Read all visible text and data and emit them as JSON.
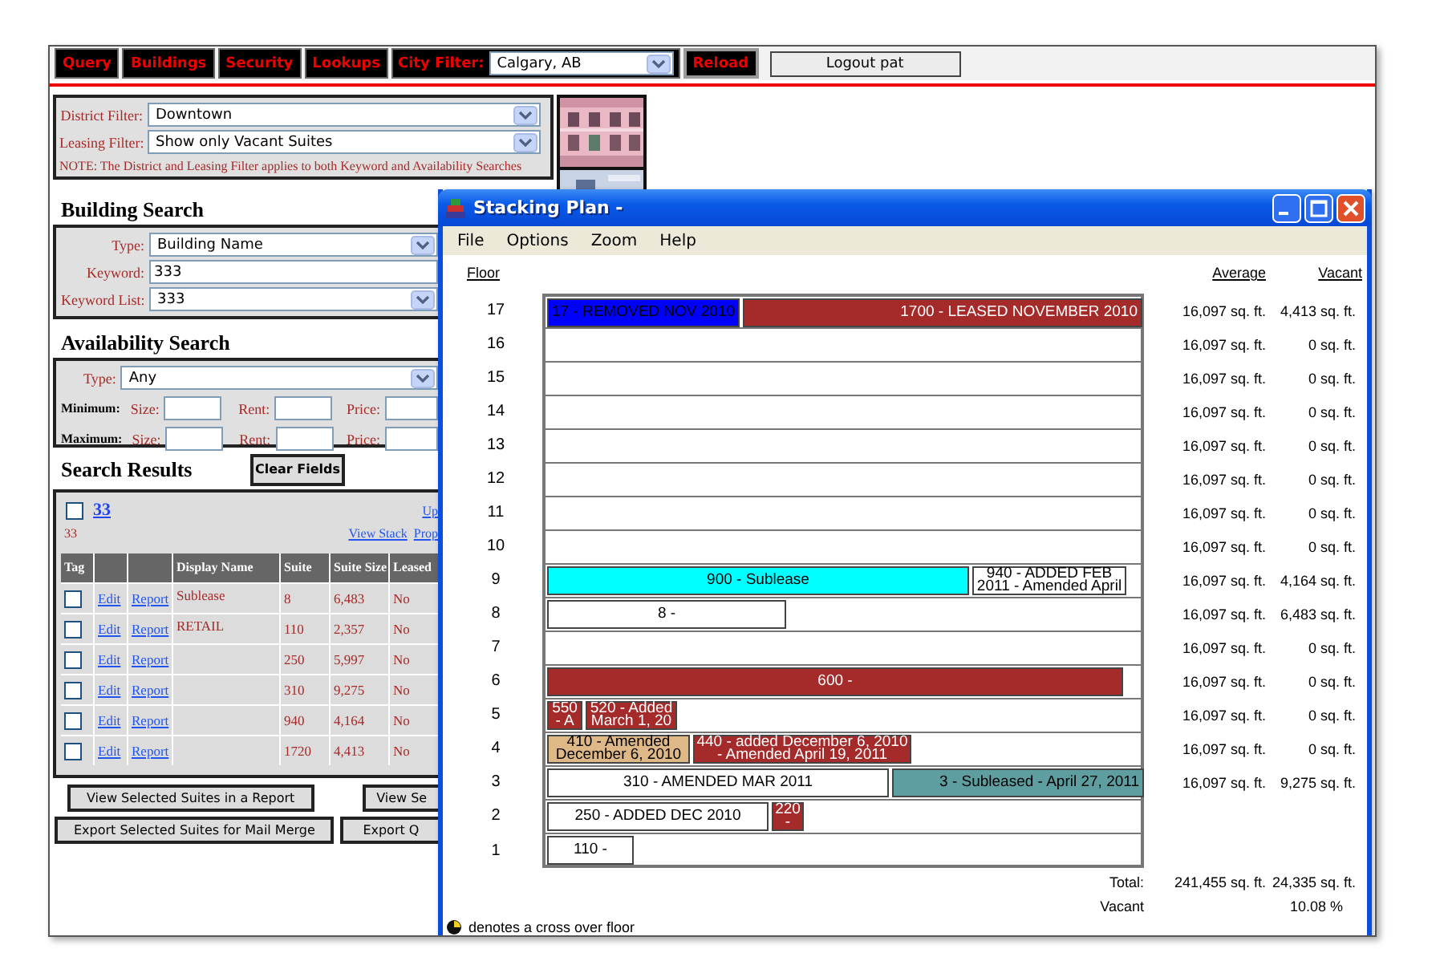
{
  "nav": {
    "buttons": [
      "Query",
      "Buildings",
      "Security",
      "Lookups"
    ],
    "city_filter": {
      "label": "City Filter:",
      "value": "Calgary, AB"
    },
    "reload_button": "Reload",
    "logout_button": "Logout pat"
  },
  "filters": {
    "district": {
      "label": "District Filter:",
      "value": "Downtown"
    },
    "leasing": {
      "label": "Leasing Filter:",
      "value": "Show only Vacant Suites"
    },
    "note": "NOTE: The District and Leasing Filter applies to both Keyword and Availability Searches"
  },
  "building_search": {
    "title": "Building Search",
    "fields": [
      {
        "kind": "select",
        "label": "Type:",
        "value": "Building Name"
      },
      {
        "kind": "input",
        "label": "Keyword:",
        "value": "333"
      },
      {
        "kind": "select",
        "label": "Keyword List:",
        "value": "333"
      }
    ]
  },
  "availability_search": {
    "title": "Availability Search",
    "type": {
      "label": "Type:",
      "value": "Any"
    },
    "ranges": [
      {
        "label": "Minimum:",
        "fields": [
          "Size:",
          "Rent:",
          "Price:"
        ]
      },
      {
        "label": "Maximum:",
        "fields": [
          "Size:",
          "Rent:",
          "Price:"
        ]
      }
    ]
  },
  "search_results": {
    "title": "Search Results",
    "clear_button": "Clear Fields",
    "select_all_checked": false,
    "count_link": "33",
    "up_link": "Up",
    "count": "33",
    "links": [
      "View Stack",
      "Prop"
    ],
    "columns": [
      {
        "kind": "text",
        "label": "Tag"
      },
      {
        "kind": "blank"
      },
      {
        "kind": "blank"
      },
      {
        "kind": "text",
        "label": "Display Name"
      },
      {
        "kind": "text",
        "label": "Suite"
      },
      {
        "kind": "text",
        "label": "Suite Size"
      },
      {
        "kind": "text",
        "label": "Leased"
      }
    ],
    "rows": [
      {
        "checked": false,
        "edit": "Edit",
        "report": "Report",
        "display_name": "Sublease",
        "suite": "8",
        "size": "6,483",
        "leased": "No"
      },
      {
        "checked": false,
        "edit": "Edit",
        "report": "Report",
        "display_name": "RETAIL",
        "suite": "110",
        "size": "2,357",
        "leased": "No"
      },
      {
        "checked": false,
        "edit": "Edit",
        "report": "Report",
        "suite": "250",
        "size": "5,997",
        "leased": "No"
      },
      {
        "checked": false,
        "edit": "Edit",
        "report": "Report",
        "suite": "310",
        "size": "9,275",
        "leased": "No"
      },
      {
        "checked": false,
        "edit": "Edit",
        "report": "Report",
        "suite": "940",
        "size": "4,164",
        "leased": "No"
      },
      {
        "checked": false,
        "edit": "Edit",
        "report": "Report",
        "suite": "1720",
        "size": "4,413",
        "leased": "No"
      }
    ],
    "button_rows": [
      [
        "View Selected Suites in a Report",
        "View Se"
      ],
      [
        "Export Selected Suites for Mail Merge",
        "Export Q"
      ]
    ]
  },
  "stacking_window": {
    "title": "Stacking Plan -",
    "menu": [
      "File",
      "Options",
      "Zoom",
      "Help"
    ],
    "headers": {
      "floor": "Floor",
      "average": "Average",
      "vacant": "Vacant"
    },
    "floors": [
      {
        "floor": "17",
        "average": "16,097 sq. ft.",
        "vacant": "4,413 sq. ft.",
        "suites": [
          {
            "label": "17 - REMOVED NOV 2010",
            "color": "#0000ff"
          },
          {
            "label": "1700 - LEASED NOVEMBER 2010",
            "color": "#a52a2a"
          }
        ]
      },
      {
        "floor": "16",
        "average": "16,097 sq. ft.",
        "vacant": "0 sq. ft."
      },
      {
        "floor": "15",
        "average": "16,097 sq. ft.",
        "vacant": "0 sq. ft."
      },
      {
        "floor": "14",
        "average": "16,097 sq. ft.",
        "vacant": "0 sq. ft."
      },
      {
        "floor": "13",
        "average": "16,097 sq. ft.",
        "vacant": "0 sq. ft."
      },
      {
        "floor": "12",
        "average": "16,097 sq. ft.",
        "vacant": "0 sq. ft."
      },
      {
        "floor": "11",
        "average": "16,097 sq. ft.",
        "vacant": "0 sq. ft."
      },
      {
        "floor": "10",
        "average": "16,097 sq. ft.",
        "vacant": "0 sq. ft."
      },
      {
        "floor": "9",
        "average": "16,097 sq. ft.",
        "vacant": "4,164 sq. ft.",
        "suites": [
          {
            "label": "900 - Sublease",
            "color": "#00ffff"
          },
          {
            "label": "940 - ADDED FEB 2011 - Amended April",
            "color": "#ffffff"
          }
        ]
      },
      {
        "floor": "8",
        "average": "16,097 sq. ft.",
        "vacant": "6,483 sq. ft.",
        "suites": [
          {
            "label": "8 -",
            "color": "#ffffff"
          }
        ]
      },
      {
        "floor": "7",
        "average": "16,097 sq. ft.",
        "vacant": "0 sq. ft."
      },
      {
        "floor": "6",
        "average": "16,097 sq. ft.",
        "vacant": "0 sq. ft.",
        "suites": [
          {
            "label": "600 -",
            "color": "#a52a2a"
          }
        ]
      },
      {
        "floor": "5",
        "average": "16,097 sq. ft.",
        "vacant": "0 sq. ft.",
        "suites": [
          {
            "label": "550 - A",
            "color": "#a52a2a"
          },
          {
            "label": "520 - Added March 1, 20",
            "color": "#a52a2a"
          }
        ]
      },
      {
        "floor": "4",
        "average": "16,097 sq. ft.",
        "vacant": "0 sq. ft.",
        "suites": [
          {
            "label": "410 - Amended December 6, 2010",
            "color": "#deb887"
          },
          {
            "label": "440 - added December 6, 2010 - Amended April 19, 2011",
            "color": "#a52a2a"
          }
        ]
      },
      {
        "floor": "3",
        "average": "16,097 sq. ft.",
        "vacant": "9,275 sq. ft.",
        "suites": [
          {
            "label": "310 - AMENDED MAR 2011",
            "color": "#ffffff"
          },
          {
            "label": "3 - Subleased - April 27, 2011",
            "color": "#5f9ea0"
          }
        ]
      },
      {
        "floor": "2",
        "suites": [
          {
            "label": "250 - ADDED DEC 2010",
            "color": "#ffffff"
          },
          {
            "label": "220 -",
            "color": "#a52a2a"
          }
        ]
      },
      {
        "floor": "1",
        "suites": [
          {
            "label": "110 -",
            "color": "#ffffff"
          }
        ]
      }
    ],
    "totals": {
      "total_label": "Total:",
      "total_average": "241,455 sq. ft.",
      "total_vacant": "24,335 sq. ft.",
      "vacant_label": "Vacant",
      "vacant_percent": "10.08 %"
    },
    "legend": "denotes a cross over floor"
  }
}
